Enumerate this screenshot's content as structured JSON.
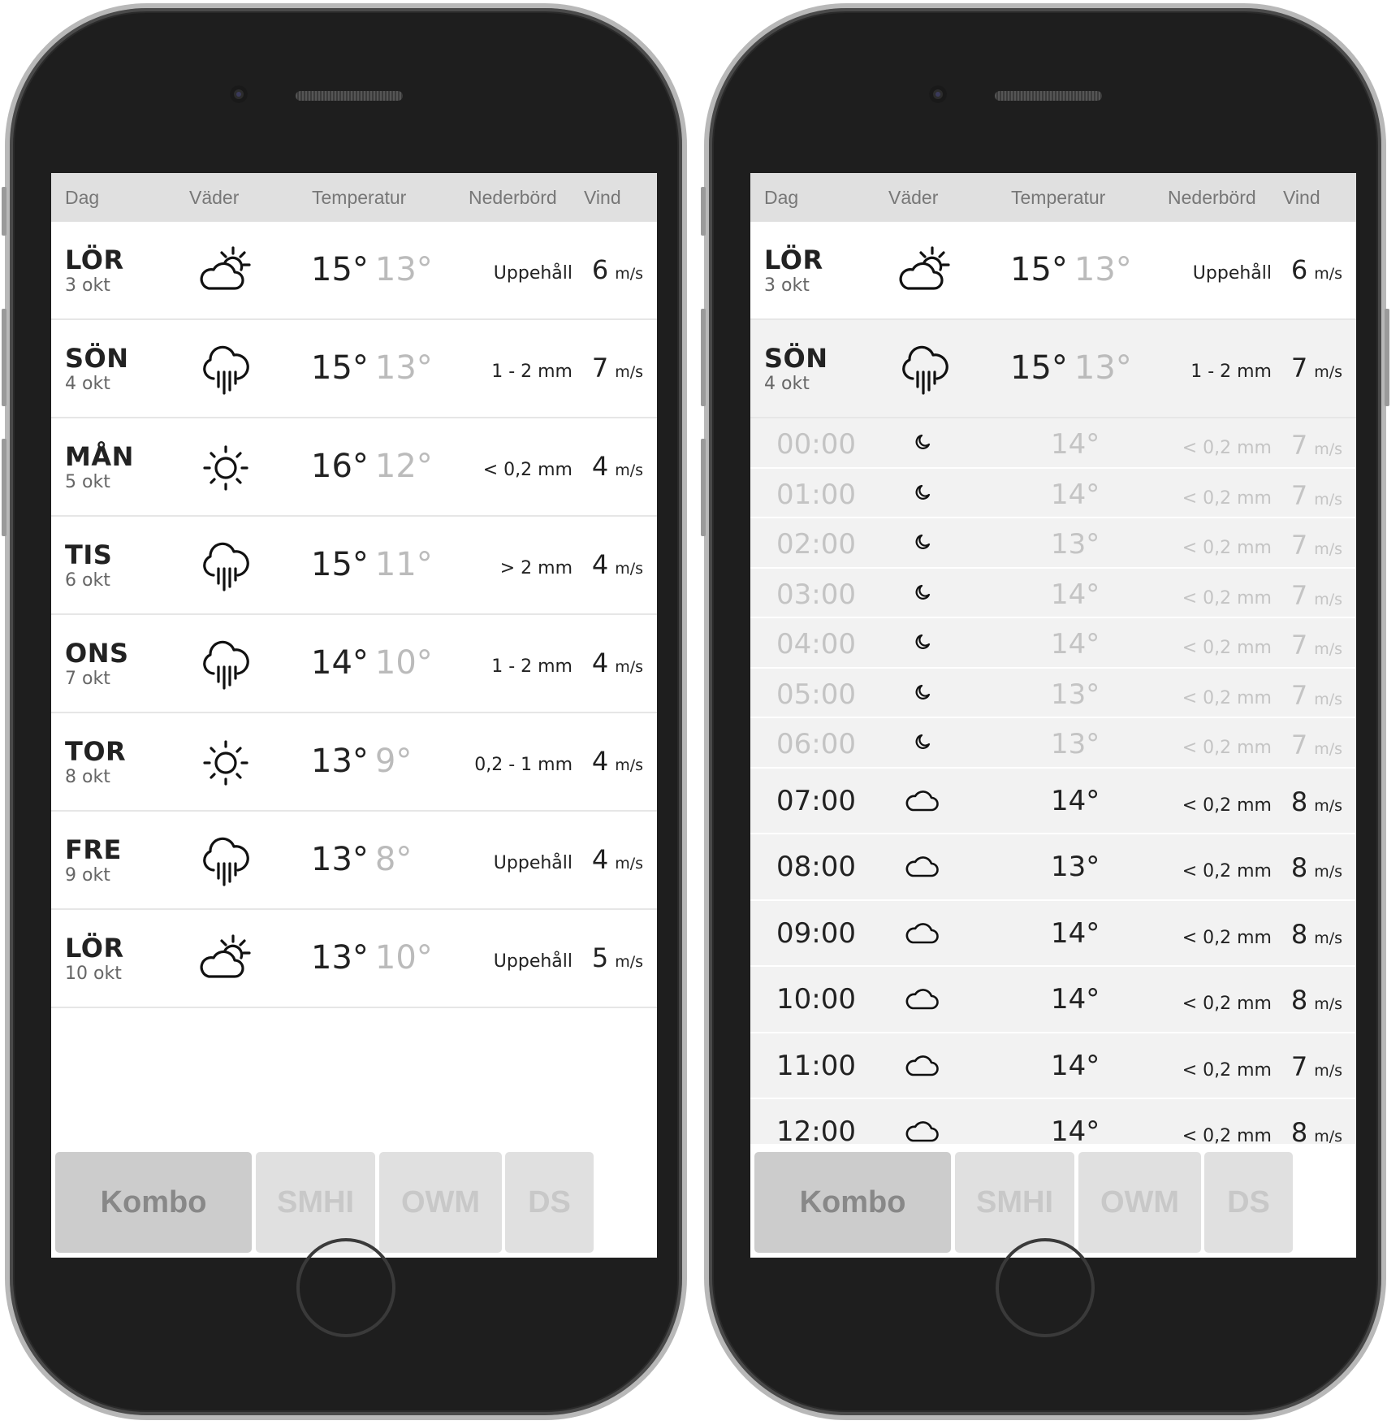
{
  "header": {
    "dag": "Dag",
    "vader": "Väder",
    "temperatur": "Temperatur",
    "nederbord": "Nederbörd",
    "vind": "Vind"
  },
  "tabs": [
    "Kombo",
    "SMHI",
    "OWM",
    "DS"
  ],
  "wind_unit": "m/s",
  "days": [
    {
      "name": "LÖR",
      "date": "3 okt",
      "icon": "partly-sunny-icon",
      "high": "15°",
      "low": "13°",
      "precip": "Uppehåll",
      "wind": "6"
    },
    {
      "name": "SÖN",
      "date": "4 okt",
      "icon": "rain-icon",
      "high": "15°",
      "low": "13°",
      "precip": "1 - 2 mm",
      "wind": "7"
    },
    {
      "name": "MÅN",
      "date": "5 okt",
      "icon": "sun-icon",
      "high": "16°",
      "low": "12°",
      "precip": "< 0,2 mm",
      "wind": "4"
    },
    {
      "name": "TIS",
      "date": "6 okt",
      "icon": "rain-icon",
      "high": "15°",
      "low": "11°",
      "precip": "> 2 mm",
      "wind": "4"
    },
    {
      "name": "ONS",
      "date": "7 okt",
      "icon": "rain-icon",
      "high": "14°",
      "low": "10°",
      "precip": "1 - 2 mm",
      "wind": "4"
    },
    {
      "name": "TOR",
      "date": "8 okt",
      "icon": "sun-icon",
      "high": "13°",
      "low": "9°",
      "precip": "0,2 - 1 mm",
      "wind": "4"
    },
    {
      "name": "FRE",
      "date": "9 okt",
      "icon": "rain-icon",
      "high": "13°",
      "low": "8°",
      "precip": "Uppehåll",
      "wind": "4"
    },
    {
      "name": "LÖR",
      "date": "10 okt",
      "icon": "partly-sunny-icon",
      "high": "13°",
      "low": "10°",
      "precip": "Uppehåll",
      "wind": "5"
    }
  ],
  "hours": [
    {
      "time": "00:00",
      "icon": "moon-icon",
      "temp": "14°",
      "precip": "< 0,2 mm",
      "wind": "7",
      "night": true
    },
    {
      "time": "01:00",
      "icon": "moon-icon",
      "temp": "14°",
      "precip": "< 0,2 mm",
      "wind": "7",
      "night": true
    },
    {
      "time": "02:00",
      "icon": "moon-icon",
      "temp": "13°",
      "precip": "< 0,2 mm",
      "wind": "7",
      "night": true
    },
    {
      "time": "03:00",
      "icon": "moon-icon",
      "temp": "14°",
      "precip": "< 0,2 mm",
      "wind": "7",
      "night": true
    },
    {
      "time": "04:00",
      "icon": "moon-icon",
      "temp": "14°",
      "precip": "< 0,2 mm",
      "wind": "7",
      "night": true
    },
    {
      "time": "05:00",
      "icon": "moon-icon",
      "temp": "13°",
      "precip": "< 0,2 mm",
      "wind": "7",
      "night": true
    },
    {
      "time": "06:00",
      "icon": "moon-icon",
      "temp": "13°",
      "precip": "< 0,2 mm",
      "wind": "7",
      "night": true
    },
    {
      "time": "07:00",
      "icon": "cloud-icon",
      "temp": "14°",
      "precip": "< 0,2 mm",
      "wind": "8",
      "night": false
    },
    {
      "time": "08:00",
      "icon": "cloud-icon",
      "temp": "13°",
      "precip": "< 0,2 mm",
      "wind": "8",
      "night": false
    },
    {
      "time": "09:00",
      "icon": "cloud-icon",
      "temp": "14°",
      "precip": "< 0,2 mm",
      "wind": "8",
      "night": false
    },
    {
      "time": "10:00",
      "icon": "cloud-icon",
      "temp": "14°",
      "precip": "< 0,2 mm",
      "wind": "8",
      "night": false
    },
    {
      "time": "11:00",
      "icon": "cloud-icon",
      "temp": "14°",
      "precip": "< 0,2 mm",
      "wind": "7",
      "night": false
    },
    {
      "time": "12:00",
      "icon": "cloud-icon",
      "temp": "14°",
      "precip": "< 0,2 mm",
      "wind": "8",
      "night": false
    }
  ]
}
